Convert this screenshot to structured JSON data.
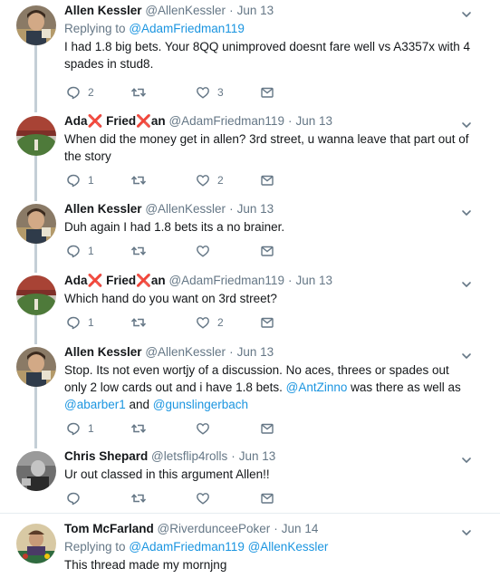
{
  "tweets": [
    {
      "name": "Allen Kessler",
      "name_parts": [
        "Allen Kessler"
      ],
      "handle": "@AllenKessler",
      "date": "Jun 13",
      "reply_prefix": "Replying to",
      "reply_to": [
        "@AdamFriedman119"
      ],
      "text": "I had 1.8 big bets. Your 8QQ unimproved doesnt fare well vs A3357x with 4 spades in stud8.",
      "replies": "2",
      "retweets": "",
      "likes": "3"
    },
    {
      "name": "Ada❌ Fried❌an",
      "name_parts": [
        "Ada",
        "❌",
        " Fried",
        "❌",
        "an"
      ],
      "handle": "@AdamFriedman119",
      "date": "Jun 13",
      "text": "When did the money get in allen? 3rd street, u wanna leave that part out of the story",
      "replies": "1",
      "retweets": "",
      "likes": "2"
    },
    {
      "name": "Allen Kessler",
      "name_parts": [
        "Allen Kessler"
      ],
      "handle": "@AllenKessler",
      "date": "Jun 13",
      "text": "Duh again I had 1.8 bets its a no brainer.",
      "replies": "1",
      "retweets": "",
      "likes": ""
    },
    {
      "name": "Ada❌ Fried❌an",
      "name_parts": [
        "Ada",
        "❌",
        " Fried",
        "❌",
        "an"
      ],
      "handle": "@AdamFriedman119",
      "date": "Jun 13",
      "text": "Which hand do you want on 3rd street?",
      "replies": "1",
      "retweets": "",
      "likes": "2"
    },
    {
      "name": "Allen Kessler",
      "name_parts": [
        "Allen Kessler"
      ],
      "handle": "@AllenKessler",
      "date": "Jun 13",
      "text_parts": [
        "Stop. Its not even wortjy of a discussion. No aces, threes or spades out only 2 low cards out and i have 1.8 bets. ",
        "@AntZinno",
        " was there as well as ",
        "@abarber1",
        " and ",
        "@gunslingerbach"
      ],
      "replies": "1",
      "retweets": "",
      "likes": ""
    },
    {
      "name": "Chris Shepard",
      "name_parts": [
        "Chris Shepard"
      ],
      "handle": "@letsflip4rolls",
      "date": "Jun 13",
      "text": "Ur out classed in this argument  Allen!!",
      "replies": "",
      "retweets": "",
      "likes": ""
    },
    {
      "name": "Tom McFarland",
      "name_parts": [
        "Tom McFarland"
      ],
      "handle": "@RiverdunceePoker",
      "date": "Jun 14",
      "reply_prefix": "Replying to",
      "reply_to": [
        "@AdamFriedman119",
        "@AllenKessler"
      ],
      "text": "This thread made my mornjng"
    }
  ],
  "separator_dot": "·",
  "icons": {
    "reply": "reply-icon",
    "retweet": "retweet-icon",
    "like": "heart-icon",
    "dm": "envelope-icon",
    "more": "chevron-down-icon"
  },
  "colors": {
    "text": "#14171a",
    "secondary": "#657786",
    "link": "#1b95e0",
    "thread_line": "#c4cfd6",
    "x_mark": "#e0245e",
    "separator": "#e6ecf0"
  }
}
